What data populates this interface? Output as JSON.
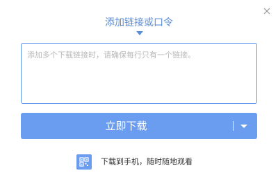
{
  "dialog": {
    "title": "添加链接或口令",
    "close_icon": "close-icon",
    "link_input": {
      "placeholder": "添加多个下载链接时，请确保每行只有一个链接。",
      "value": ""
    },
    "download_button": {
      "label": "立即下载",
      "dropdown_icon": "caret-down-icon"
    },
    "mobile_download": {
      "icon": "qr-code-icon",
      "label": "下载到手机，随时随地观看"
    }
  },
  "colors": {
    "accent": "#5b8dd9",
    "button": "#6a9cf0",
    "input_border": "#5f95e8",
    "placeholder": "#b8b8b8"
  }
}
